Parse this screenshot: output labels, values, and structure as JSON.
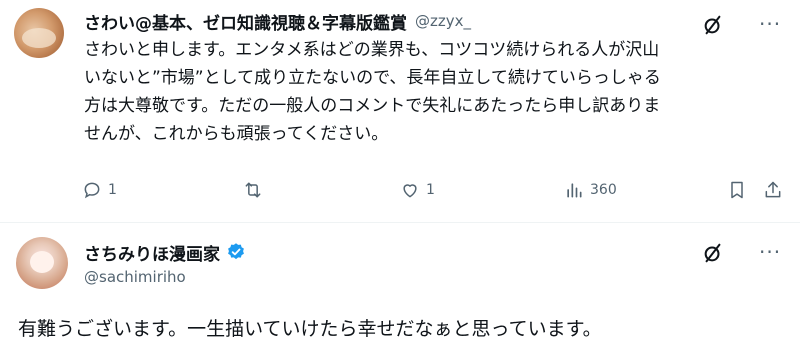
{
  "reply1": {
    "author_name": "さわい@基本、ゼロ知識視聴＆字幕版鑑賞",
    "author_handle": "@zzyx_",
    "lines": [
      "さわいと申します。エンタメ系はどの業界も、コツコツ続けられる人が沢山",
      "いないと”市場”として成り立たないので、長年自立して続けていらっしゃる",
      "方は大尊敬です。ただの一般人のコメントで失礼にあたったら申し訳ありま",
      "せんが、これからも頑張ってください。"
    ],
    "replies": "1",
    "likes": "1",
    "views": "360"
  },
  "reply2": {
    "author_name": "さちみりほ漫画家",
    "author_handle": "@sachimiriho",
    "text": "有難うございます。一生描いていけたら幸せだなぁと思っています。"
  },
  "icons": {
    "grok": "grok-icon",
    "reply": "reply-icon",
    "retweet": "retweet-icon",
    "like": "like-icon",
    "views": "views-icon",
    "bookmark": "bookmark-icon",
    "share": "share-icon",
    "verified": "verified-badge-icon"
  },
  "colors": {
    "verified": "#1d9bf0",
    "secondary": "#536471"
  }
}
